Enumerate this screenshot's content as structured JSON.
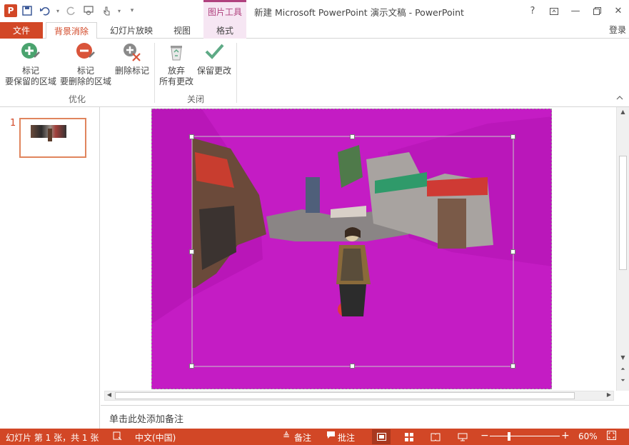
{
  "titlebar": {
    "app_icon": "P",
    "title": "新建 Microsoft PowerPoint 演示文稿 - PowerPoint",
    "context_group": "图片工具",
    "qat_icons": [
      "save-icon",
      "undo-icon",
      "redo-icon",
      "touch-mode-icon",
      "customize-icon"
    ],
    "window_icons": [
      "help-icon",
      "ribbon-display-icon",
      "minimize-icon",
      "restore-icon",
      "close-icon"
    ],
    "help_glyph": "?",
    "minimize_glyph": "—",
    "close_glyph": "✕"
  },
  "tabs": {
    "file": "文件",
    "active": "背景消除",
    "slideshow": "幻灯片放映",
    "view": "视图",
    "format": "格式",
    "signin": "登录"
  },
  "ribbon": {
    "mark_keep": {
      "line1": "标记",
      "line2": "要保留的区域"
    },
    "mark_remove": {
      "line1": "标记",
      "line2": "要删除的区域"
    },
    "delete_mark": "删除标记",
    "discard": {
      "line1": "放弃",
      "line2": "所有更改"
    },
    "keep_changes": "保留更改",
    "group_refine": "优化",
    "group_close": "关闭",
    "colors": {
      "green": "#4aa36e",
      "red": "#d9543a",
      "gray": "#8a8a8a",
      "teal": "#5eaa86"
    }
  },
  "slides": {
    "number": "1"
  },
  "notes": {
    "placeholder": "单击此处添加备注"
  },
  "status": {
    "slide_info": "幻灯片 第 1 张，共 1 张",
    "language": "中文(中国)",
    "notes": "备注",
    "comments": "批注",
    "zoom": "60%",
    "zoom_level": 0.6
  },
  "colors": {
    "accent": "#d24726",
    "removal_overlay": "#c41cc4",
    "context_tab": "#b0417e"
  }
}
